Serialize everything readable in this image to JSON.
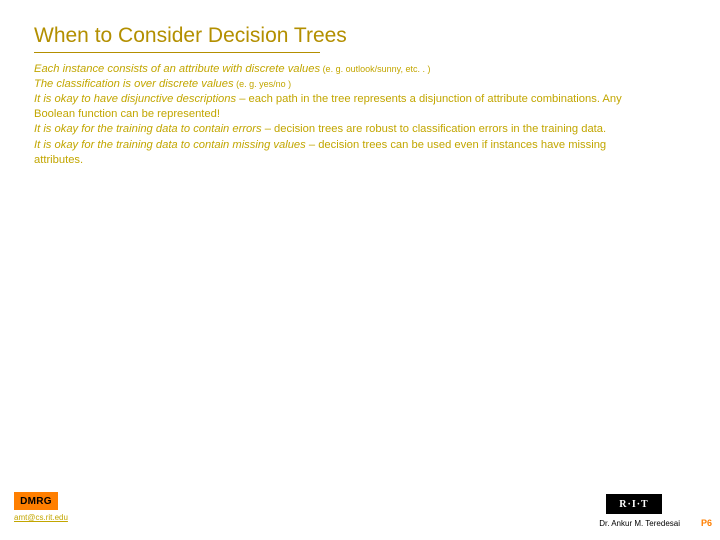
{
  "title": "When to Consider Decision Trees",
  "bullets": [
    {
      "em": "Each instance consists of an attribute with discrete values",
      "small": " (e. g. outlook/sunny, etc. . )",
      "rest": ""
    },
    {
      "em": "The classification is over discrete values",
      "small": " (e. g. yes/no )",
      "rest": ""
    },
    {
      "em": "It is okay to have disjunctive descriptions",
      "small": "",
      "rest": " – each path in the tree represents a disjunction of attribute combinations. Any Boolean function can be represented!"
    },
    {
      "em": "It is okay for the training data to contain errors",
      "small": "",
      "rest": " – decision trees are robust to classification errors in the training data."
    },
    {
      "em": "It is okay for the training data to contain missing values",
      "small": "",
      "rest": " – decision trees can be used even if instances have missing attributes."
    }
  ],
  "logo_left": "DMRG",
  "email": "amt@cs.rit.edu",
  "logo_right": "R·I·T",
  "author": "Dr. Ankur M. Teredesai",
  "page": "P6"
}
